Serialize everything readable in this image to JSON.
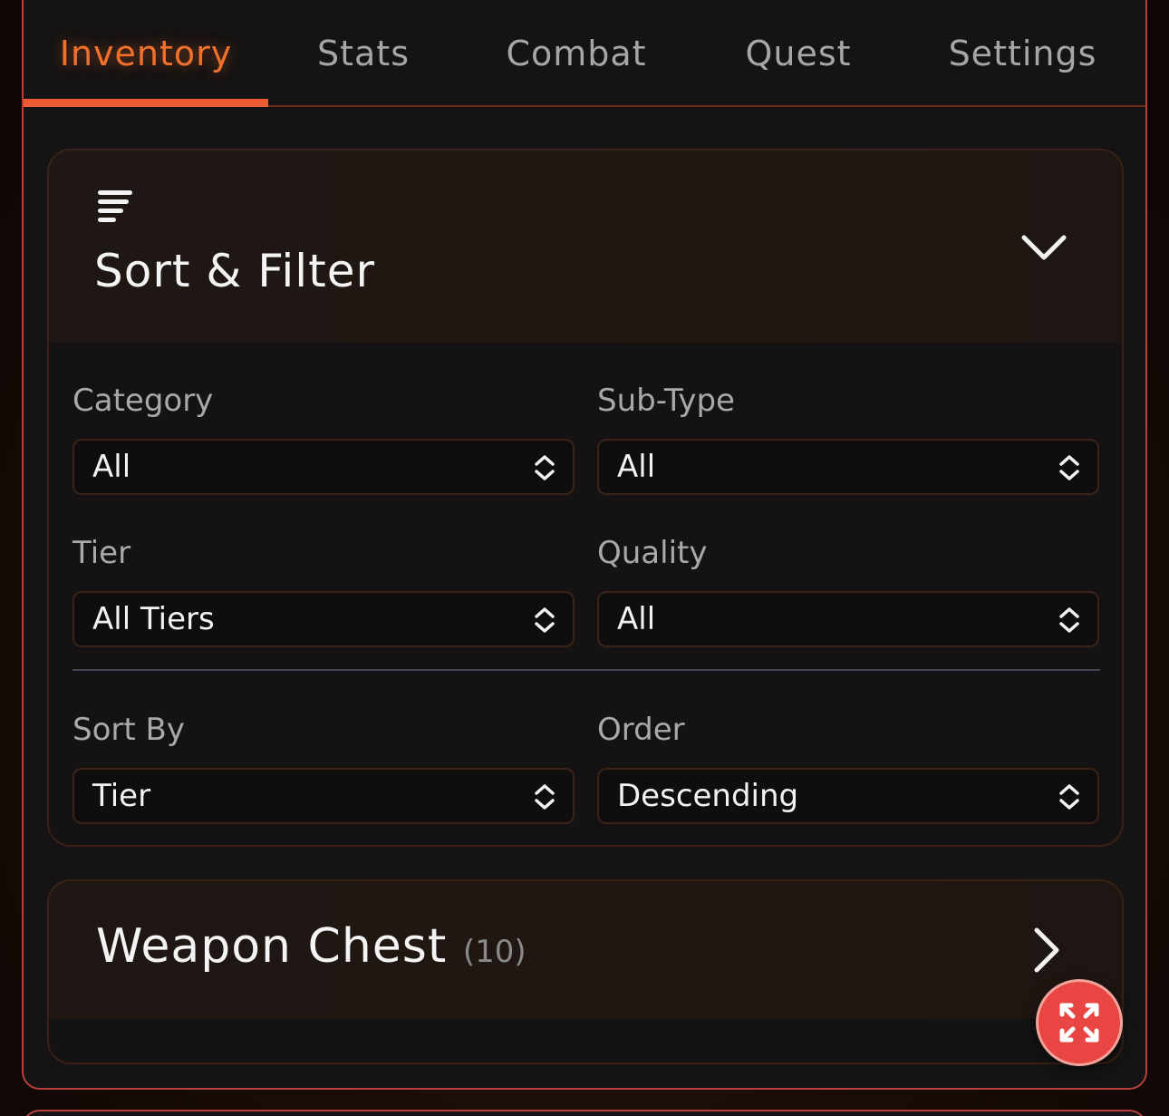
{
  "tabs": [
    {
      "label": "Inventory",
      "active": true
    },
    {
      "label": "Stats",
      "active": false
    },
    {
      "label": "Combat",
      "active": false
    },
    {
      "label": "Quest",
      "active": false
    },
    {
      "label": "Settings",
      "active": false
    }
  ],
  "sort_filter": {
    "title": "Sort & Filter",
    "icon": "filter-lines-icon",
    "toggle_icon": "chevron-down-icon",
    "fields": {
      "category": {
        "label": "Category",
        "value": "All"
      },
      "subtype": {
        "label": "Sub-Type",
        "value": "All"
      },
      "tier": {
        "label": "Tier",
        "value": "All Tiers"
      },
      "quality": {
        "label": "Quality",
        "value": "All"
      },
      "sort_by": {
        "label": "Sort By",
        "value": "Tier"
      },
      "order": {
        "label": "Order",
        "value": "Descending"
      }
    }
  },
  "weapon_chest": {
    "title": "Weapon Chest",
    "count": "(10)",
    "toggle_icon": "chevron-right-icon"
  },
  "fab": {
    "icon": "expand-arrows-icon"
  },
  "colors": {
    "accent": "#f0702e",
    "tab_underline": "#ee5a32",
    "border": "#b8403a",
    "fab": "#e94542"
  }
}
